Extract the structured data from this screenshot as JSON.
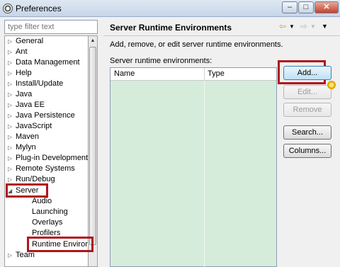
{
  "window": {
    "title": "Preferences"
  },
  "filter": {
    "placeholder": "type filter text"
  },
  "tree": {
    "items": [
      {
        "label": "General",
        "expanded": false
      },
      {
        "label": "Ant",
        "expanded": false
      },
      {
        "label": "Data Management",
        "expanded": false
      },
      {
        "label": "Help",
        "expanded": false
      },
      {
        "label": "Install/Update",
        "expanded": false
      },
      {
        "label": "Java",
        "expanded": false
      },
      {
        "label": "Java EE",
        "expanded": false
      },
      {
        "label": "Java Persistence",
        "expanded": false
      },
      {
        "label": "JavaScript",
        "expanded": false
      },
      {
        "label": "Maven",
        "expanded": false
      },
      {
        "label": "Mylyn",
        "expanded": false
      },
      {
        "label": "Plug-in Development",
        "expanded": false
      },
      {
        "label": "Remote Systems",
        "expanded": false
      },
      {
        "label": "Run/Debug",
        "expanded": false
      },
      {
        "label": "Server",
        "expanded": true
      },
      {
        "label": "Audio",
        "child": true
      },
      {
        "label": "Launching",
        "child": true
      },
      {
        "label": "Overlays",
        "child": true
      },
      {
        "label": "Profilers",
        "child": true
      },
      {
        "label": "Runtime Environm",
        "child": true,
        "selected": true
      },
      {
        "label": "Team",
        "expanded": false
      }
    ]
  },
  "page": {
    "title": "Server Runtime Environments",
    "description": "Add, remove, or edit server runtime environments.",
    "list_label": "Server runtime environments:"
  },
  "table": {
    "columns": [
      "Name",
      "Type"
    ],
    "rows": []
  },
  "buttons": {
    "add": "Add...",
    "edit": "Edit...",
    "remove": "Remove",
    "search": "Search...",
    "columns": "Columns..."
  },
  "icons": {
    "back": "back-arrow-icon",
    "forward": "forward-arrow-icon",
    "menu": "view-menu-icon"
  },
  "colors": {
    "highlight_box": "#b0161b",
    "table_bg": "#d6ecdb"
  }
}
